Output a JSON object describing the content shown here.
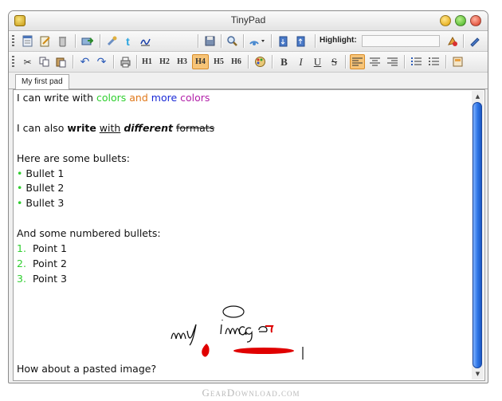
{
  "window": {
    "title": "TinyPad"
  },
  "toolbar1": {
    "highlight_label": "Highlight:",
    "highlight_value": "",
    "buttons": [
      "new-doc",
      "edit-doc",
      "delete",
      "open",
      "tools",
      "twitter",
      "signature",
      "save",
      "find",
      "broadcast",
      "import",
      "export",
      "clear-highlight",
      "pen"
    ]
  },
  "toolbar2": {
    "headings": [
      "H1",
      "H2",
      "H3",
      "H4",
      "H5",
      "H6"
    ],
    "active_heading": "H4",
    "bold": "B",
    "italic": "I",
    "underline": "U",
    "strike": "S",
    "active_alignment": "left"
  },
  "tabs": [
    {
      "label": "My first pad",
      "active": true
    }
  ],
  "document": {
    "line1": {
      "prefix": "I can write with ",
      "w1": "colors",
      "w2": "and",
      "w3": "more",
      "w4": "colors"
    },
    "line2": {
      "prefix": "I can also ",
      "bold": "write",
      "underline": "with",
      "bolditalic": "different",
      "strike": "formats"
    },
    "bullets_intro": "Here are some bullets:",
    "bullets": [
      "Bullet 1",
      "Bullet 2",
      "Bullet 3"
    ],
    "numbered_intro": "And some numbered bullets:",
    "numbered": [
      {
        "n": "1.",
        "text": "Point 1"
      },
      {
        "n": "2.",
        "text": "Point 2"
      },
      {
        "n": "3.",
        "text": "Point 3"
      }
    ],
    "image_prompt": "How about a pasted image?",
    "image_text": "my image"
  },
  "colors": {
    "green": "#2fcf2f",
    "orange": "#e0781a",
    "blue": "#1a2ad6",
    "purple": "#b11fa8",
    "scrollbar": "#2d74e6",
    "active_button": "#f7c477"
  },
  "watermark": "GearDownload.com"
}
